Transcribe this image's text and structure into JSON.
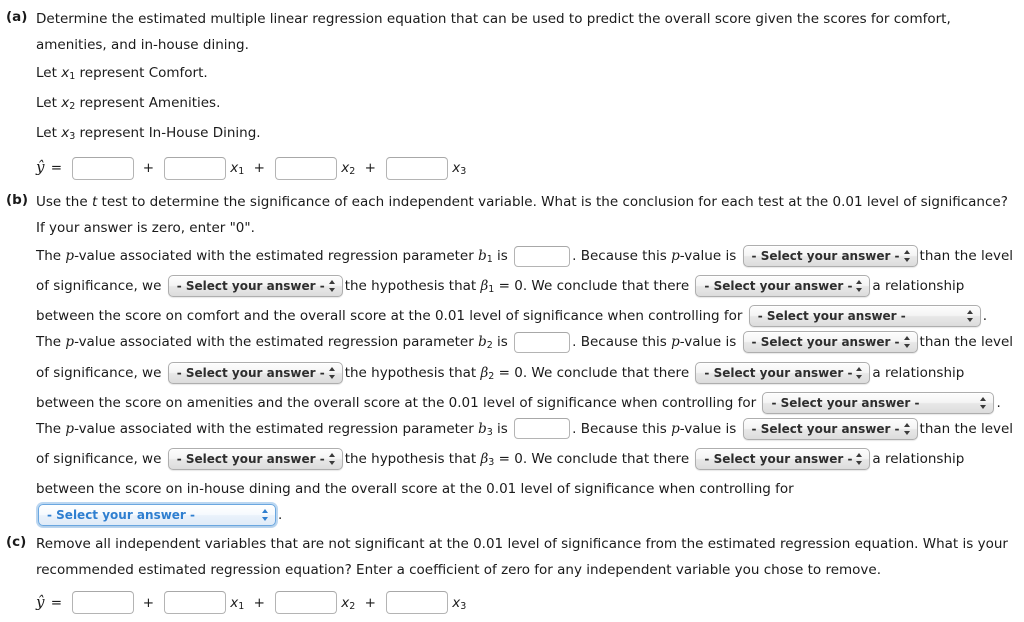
{
  "parts": {
    "a": {
      "label": "(a)",
      "prompt": "Determine the estimated multiple linear regression equation that can be used to predict the overall score given the scores for comfort, amenities, and in-house dining.",
      "let_lines": [
        {
          "prefix": "Let ",
          "var": "x",
          "sub": "1",
          "suffix": " represent Comfort."
        },
        {
          "prefix": "Let ",
          "var": "x",
          "sub": "2",
          "suffix": " represent Amenities."
        },
        {
          "prefix": "Let ",
          "var": "x",
          "sub": "3",
          "suffix": " represent In-House Dining."
        }
      ],
      "equation": {
        "lhs": "ŷ",
        "equals": "=",
        "plus": "+",
        "terms": [
          {
            "value": "",
            "var": ""
          },
          {
            "value": "",
            "var": "x",
            "sub": "1"
          },
          {
            "value": "",
            "var": "x",
            "sub": "2"
          },
          {
            "value": "",
            "var": "x",
            "sub": "3"
          }
        ]
      }
    },
    "b": {
      "label": "(b)",
      "prompt_1": "Use the ",
      "prompt_t": "t",
      "prompt_2": " test to determine the significance of each independent variable. What is the conclusion for each test at the 0.01 level of significance? If your answer is zero, enter \"0\".",
      "statements": [
        {
          "s1": "The ",
          "p": "p",
          "s2": "-value associated with the estimated regression parameter ",
          "param": "b",
          "param_sub": "1",
          "s3": " is",
          "pvalue_input": "",
          "s4": ". Because this ",
          "s5": "-value is",
          "select_compare": "- Select your answer -",
          "s6": "than the level of significance, we",
          "select_hypothesis": "- Select your answer -",
          "s7": "the hypothesis that ",
          "beta": "β",
          "beta_sub": "1",
          "s8": " = 0. We conclude that there",
          "select_relationship": "- Select your answer -",
          "s9": "a relationship between the score on comfort and the overall score at the 0.01 level of significance when controlling for",
          "select_controlling": "- Select your answer -",
          "s10": "."
        },
        {
          "s1": "The ",
          "p": "p",
          "s2": "-value associated with the estimated regression parameter ",
          "param": "b",
          "param_sub": "2",
          "s3": " is",
          "pvalue_input": "",
          "s4": ". Because this ",
          "s5": "-value is",
          "select_compare": "- Select your answer -",
          "s6": "than the level of significance, we",
          "select_hypothesis": "- Select your answer -",
          "s7": "the hypothesis that ",
          "beta": "β",
          "beta_sub": "2",
          "s8": " = 0. We conclude that there",
          "select_relationship": "- Select your answer -",
          "s9": "a relationship between the score on amenities and the overall score at the 0.01 level of significance when controlling for",
          "select_controlling": "- Select your answer -",
          "s10": "."
        },
        {
          "s1": "The ",
          "p": "p",
          "s2": "-value associated with the estimated regression parameter ",
          "param": "b",
          "param_sub": "3",
          "s3": " is",
          "pvalue_input": "",
          "s4": ". Because this ",
          "s5": "-value is",
          "select_compare": "- Select your answer -",
          "s6": "than the level of significance, we",
          "select_hypothesis": "- Select your answer -",
          "s7": "the hypothesis that ",
          "beta": "β",
          "beta_sub": "3",
          "s8": " = 0. We conclude that there",
          "select_relationship": "- Select your answer -",
          "s9": "a relationship between the score on in-house dining and the overall score at the 0.01 level of significance when controlling for",
          "select_controlling": "- Select your answer -",
          "s10": "."
        }
      ]
    },
    "c": {
      "label": "(c)",
      "prompt": "Remove all independent variables that are not significant at the 0.01 level of significance from the estimated regression equation. What is your recommended estimated regression equation? Enter a coefficient of zero for any independent variable you chose to remove.",
      "equation": {
        "lhs": "ŷ",
        "equals": "=",
        "plus": "+",
        "terms": [
          {
            "value": "",
            "var": ""
          },
          {
            "value": "",
            "var": "x",
            "sub": "1"
          },
          {
            "value": "",
            "var": "x",
            "sub": "2"
          },
          {
            "value": "",
            "var": "x",
            "sub": "3"
          }
        ]
      }
    }
  },
  "colors": {
    "text": "#1a1a1a",
    "focus_blue": "#2f7fd0",
    "focus_border": "#6aa7e0",
    "input_border": "#b4b4b4",
    "select_border": "#aeaeae"
  }
}
